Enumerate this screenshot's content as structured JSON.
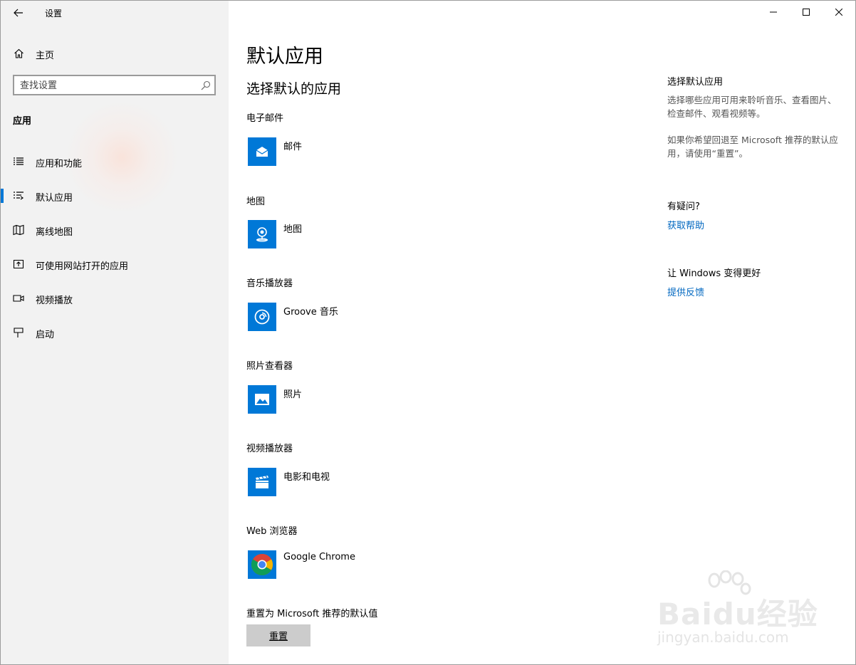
{
  "window": {
    "app_title": "设置",
    "controls": {
      "minimize": "minimize-icon",
      "maximize": "maximize-icon",
      "close": "close-icon"
    }
  },
  "sidebar": {
    "home_label": "主页",
    "search_placeholder": "查找设置",
    "section_title": "应用",
    "items": [
      {
        "label": "应用和功能",
        "icon": "apps-features-icon",
        "active": false
      },
      {
        "label": "默认应用",
        "icon": "default-apps-icon",
        "active": true
      },
      {
        "label": "离线地图",
        "icon": "offline-maps-icon",
        "active": false
      },
      {
        "label": "可使用网站打开的应用",
        "icon": "apps-for-websites-icon",
        "active": false
      },
      {
        "label": "视频播放",
        "icon": "video-playback-icon",
        "active": false
      },
      {
        "label": "启动",
        "icon": "startup-icon",
        "active": false
      }
    ]
  },
  "main": {
    "page_title": "默认应用",
    "sub_title": "选择默认的应用",
    "categories": [
      {
        "label": "电子邮件",
        "app": "邮件",
        "icon": "mail-icon"
      },
      {
        "label": "地图",
        "app": "地图",
        "icon": "maps-icon"
      },
      {
        "label": "音乐播放器",
        "app": "Groove 音乐",
        "icon": "groove-music-icon"
      },
      {
        "label": "照片查看器",
        "app": "照片",
        "icon": "photos-icon"
      },
      {
        "label": "视频播放器",
        "app": "电影和电视",
        "icon": "movies-tv-icon"
      },
      {
        "label": "Web 浏览器",
        "app": "Google Chrome",
        "icon": "chrome-icon"
      }
    ],
    "reset_label": "重置为 Microsoft 推荐的默认值",
    "reset_button": "重置"
  },
  "right_panel": {
    "heading1": "选择默认应用",
    "para1": "选择哪些应用可用来聆听音乐、查看图片、检查邮件、观看视频等。",
    "para2": "如果你希望回退至 Microsoft 推荐的默认应用，请使用“重置”。",
    "heading2": "有疑问?",
    "link_help": "获取帮助",
    "heading3": "让 Windows 变得更好",
    "link_feedback": "提供反馈"
  },
  "watermark": {
    "brand": "Baidu经验",
    "url": "jingyan.baidu.com"
  },
  "colors": {
    "accent": "#0078d7",
    "link": "#0067c0",
    "sidebar_bg": "#f2f2f2",
    "button_bg": "#cccccc"
  }
}
